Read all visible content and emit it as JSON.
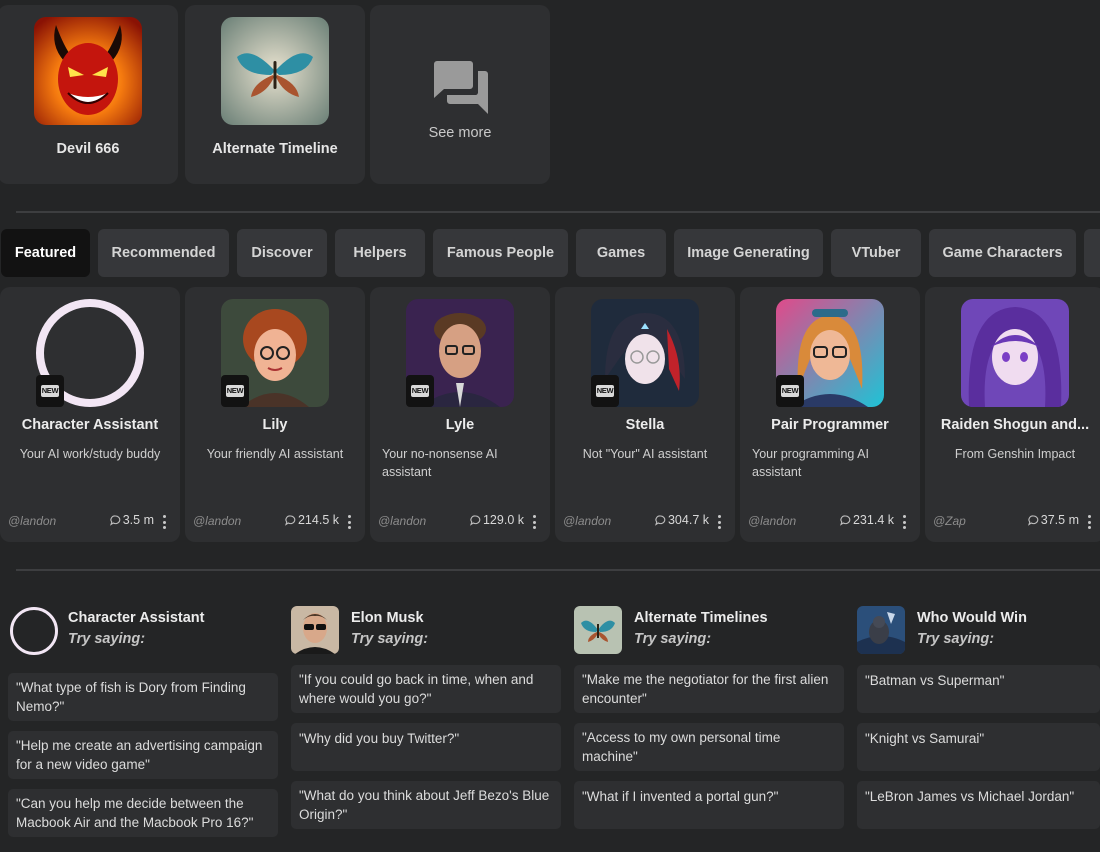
{
  "top_row": {
    "items": [
      {
        "name": "Devil 666"
      },
      {
        "name": "Alternate Timeline"
      }
    ],
    "see_more_label": "See more"
  },
  "tabs": [
    "Featured",
    "Recommended",
    "Discover",
    "Helpers",
    "Famous People",
    "Games",
    "Image Generating",
    "VTuber",
    "Game Characters"
  ],
  "active_tab": "Featured",
  "characters": [
    {
      "name": "Character Assistant",
      "desc": "Your AI work/study buddy",
      "author": "@landon",
      "count": "3.5 m",
      "new_badge": "NEW"
    },
    {
      "name": "Lily",
      "desc": "Your friendly AI assistant",
      "author": "@landon",
      "count": "214.5 k",
      "new_badge": "NEW"
    },
    {
      "name": "Lyle",
      "desc": "Your no-nonsense AI assistant",
      "author": "@landon",
      "count": "129.0 k",
      "new_badge": "NEW"
    },
    {
      "name": "Stella",
      "desc": "Not \"Your\" AI assistant",
      "author": "@landon",
      "count": "304.7 k",
      "new_badge": "NEW"
    },
    {
      "name": "Pair Programmer",
      "desc": "Your programming AI assistant",
      "author": "@landon",
      "count": "231.4 k",
      "new_badge": "NEW"
    },
    {
      "name": "Raiden Shogun and...",
      "desc": "From Genshin Impact",
      "author": "@Zap",
      "count": "37.5 m"
    }
  ],
  "suggestions": [
    {
      "name": "Character Assistant",
      "subtitle": "Try saying:",
      "prompts": [
        "\"What type of fish is Dory from Finding Nemo?\"",
        "\"Help me create an advertising campaign for a new video game\"",
        "\"Can you help me decide between the Macbook Air and the Macbook Pro 16?\""
      ]
    },
    {
      "name": "Elon Musk",
      "subtitle": "Try saying:",
      "prompts": [
        "\"If you could go back in time, when and where would you go?\"",
        "\"Why did you buy Twitter?\"",
        "\"What do you think about Jeff Bezo's Blue Origin?\""
      ]
    },
    {
      "name": "Alternate Timelines",
      "subtitle": "Try saying:",
      "prompts": [
        "\"Make me the negotiator for the first alien encounter\"",
        "\"Access to my own personal time machine\"",
        "\"What if I invented a portal gun?\""
      ]
    },
    {
      "name": "Who Would Win",
      "subtitle": "Try saying:",
      "prompts": [
        "\"Batman vs Superman\"",
        "\"Knight vs Samurai\"",
        "\"LeBron James vs Michael Jordan\""
      ]
    }
  ],
  "colors": {
    "background": "#242526",
    "card": "#2e2f31",
    "tab": "#36373a",
    "active_tab": "#121212"
  }
}
